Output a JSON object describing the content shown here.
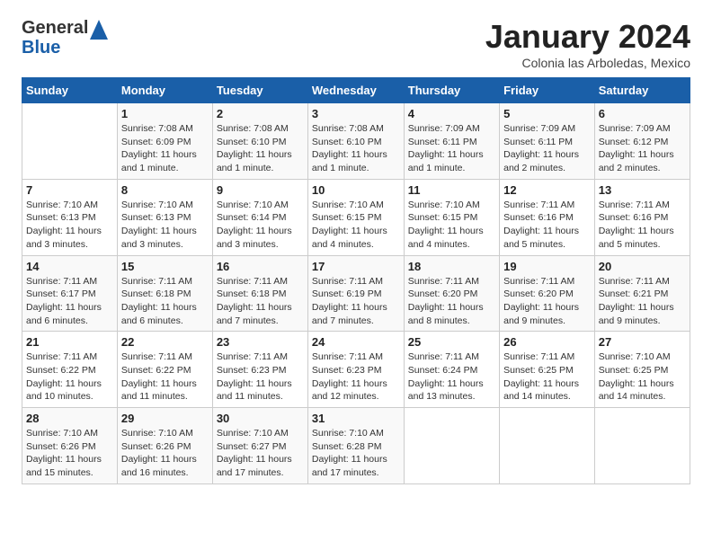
{
  "logo": {
    "general": "General",
    "blue": "Blue"
  },
  "header": {
    "month": "January 2024",
    "location": "Colonia las Arboledas, Mexico"
  },
  "weekdays": [
    "Sunday",
    "Monday",
    "Tuesday",
    "Wednesday",
    "Thursday",
    "Friday",
    "Saturday"
  ],
  "weeks": [
    [
      {
        "day": "",
        "info": ""
      },
      {
        "day": "1",
        "info": "Sunrise: 7:08 AM\nSunset: 6:09 PM\nDaylight: 11 hours\nand 1 minute."
      },
      {
        "day": "2",
        "info": "Sunrise: 7:08 AM\nSunset: 6:10 PM\nDaylight: 11 hours\nand 1 minute."
      },
      {
        "day": "3",
        "info": "Sunrise: 7:08 AM\nSunset: 6:10 PM\nDaylight: 11 hours\nand 1 minute."
      },
      {
        "day": "4",
        "info": "Sunrise: 7:09 AM\nSunset: 6:11 PM\nDaylight: 11 hours\nand 1 minute."
      },
      {
        "day": "5",
        "info": "Sunrise: 7:09 AM\nSunset: 6:11 PM\nDaylight: 11 hours\nand 2 minutes."
      },
      {
        "day": "6",
        "info": "Sunrise: 7:09 AM\nSunset: 6:12 PM\nDaylight: 11 hours\nand 2 minutes."
      }
    ],
    [
      {
        "day": "7",
        "info": "Sunrise: 7:10 AM\nSunset: 6:13 PM\nDaylight: 11 hours\nand 3 minutes."
      },
      {
        "day": "8",
        "info": "Sunrise: 7:10 AM\nSunset: 6:13 PM\nDaylight: 11 hours\nand 3 minutes."
      },
      {
        "day": "9",
        "info": "Sunrise: 7:10 AM\nSunset: 6:14 PM\nDaylight: 11 hours\nand 3 minutes."
      },
      {
        "day": "10",
        "info": "Sunrise: 7:10 AM\nSunset: 6:15 PM\nDaylight: 11 hours\nand 4 minutes."
      },
      {
        "day": "11",
        "info": "Sunrise: 7:10 AM\nSunset: 6:15 PM\nDaylight: 11 hours\nand 4 minutes."
      },
      {
        "day": "12",
        "info": "Sunrise: 7:11 AM\nSunset: 6:16 PM\nDaylight: 11 hours\nand 5 minutes."
      },
      {
        "day": "13",
        "info": "Sunrise: 7:11 AM\nSunset: 6:16 PM\nDaylight: 11 hours\nand 5 minutes."
      }
    ],
    [
      {
        "day": "14",
        "info": "Sunrise: 7:11 AM\nSunset: 6:17 PM\nDaylight: 11 hours\nand 6 minutes."
      },
      {
        "day": "15",
        "info": "Sunrise: 7:11 AM\nSunset: 6:18 PM\nDaylight: 11 hours\nand 6 minutes."
      },
      {
        "day": "16",
        "info": "Sunrise: 7:11 AM\nSunset: 6:18 PM\nDaylight: 11 hours\nand 7 minutes."
      },
      {
        "day": "17",
        "info": "Sunrise: 7:11 AM\nSunset: 6:19 PM\nDaylight: 11 hours\nand 7 minutes."
      },
      {
        "day": "18",
        "info": "Sunrise: 7:11 AM\nSunset: 6:20 PM\nDaylight: 11 hours\nand 8 minutes."
      },
      {
        "day": "19",
        "info": "Sunrise: 7:11 AM\nSunset: 6:20 PM\nDaylight: 11 hours\nand 9 minutes."
      },
      {
        "day": "20",
        "info": "Sunrise: 7:11 AM\nSunset: 6:21 PM\nDaylight: 11 hours\nand 9 minutes."
      }
    ],
    [
      {
        "day": "21",
        "info": "Sunrise: 7:11 AM\nSunset: 6:22 PM\nDaylight: 11 hours\nand 10 minutes."
      },
      {
        "day": "22",
        "info": "Sunrise: 7:11 AM\nSunset: 6:22 PM\nDaylight: 11 hours\nand 11 minutes."
      },
      {
        "day": "23",
        "info": "Sunrise: 7:11 AM\nSunset: 6:23 PM\nDaylight: 11 hours\nand 11 minutes."
      },
      {
        "day": "24",
        "info": "Sunrise: 7:11 AM\nSunset: 6:23 PM\nDaylight: 11 hours\nand 12 minutes."
      },
      {
        "day": "25",
        "info": "Sunrise: 7:11 AM\nSunset: 6:24 PM\nDaylight: 11 hours\nand 13 minutes."
      },
      {
        "day": "26",
        "info": "Sunrise: 7:11 AM\nSunset: 6:25 PM\nDaylight: 11 hours\nand 14 minutes."
      },
      {
        "day": "27",
        "info": "Sunrise: 7:10 AM\nSunset: 6:25 PM\nDaylight: 11 hours\nand 14 minutes."
      }
    ],
    [
      {
        "day": "28",
        "info": "Sunrise: 7:10 AM\nSunset: 6:26 PM\nDaylight: 11 hours\nand 15 minutes."
      },
      {
        "day": "29",
        "info": "Sunrise: 7:10 AM\nSunset: 6:26 PM\nDaylight: 11 hours\nand 16 minutes."
      },
      {
        "day": "30",
        "info": "Sunrise: 7:10 AM\nSunset: 6:27 PM\nDaylight: 11 hours\nand 17 minutes."
      },
      {
        "day": "31",
        "info": "Sunrise: 7:10 AM\nSunset: 6:28 PM\nDaylight: 11 hours\nand 17 minutes."
      },
      {
        "day": "",
        "info": ""
      },
      {
        "day": "",
        "info": ""
      },
      {
        "day": "",
        "info": ""
      }
    ]
  ]
}
